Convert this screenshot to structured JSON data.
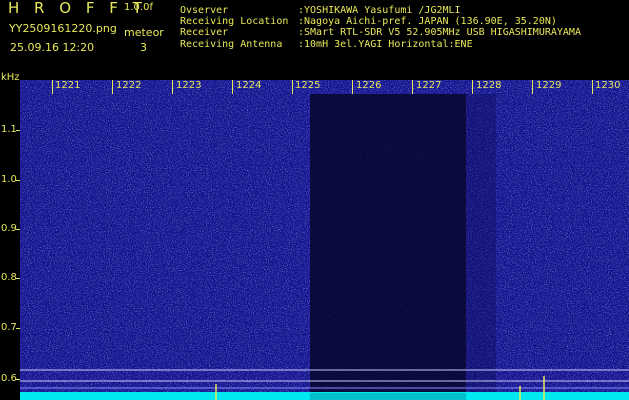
{
  "header": {
    "app_name": "H R O F F T",
    "version": "1.0.0f",
    "filename": "YY2509161220.png",
    "datetime": "25.09.16 12:20",
    "meteor_label": "meteor",
    "meteor_count": "3"
  },
  "info": [
    {
      "key": "Ovserver",
      "value": ":YOSHIKAWA Yasufumi /JG2MLI"
    },
    {
      "key": "Receiving Location",
      "value": ":Nagoya Aichi-pref. JAPAN (136.90E, 35.20N)"
    },
    {
      "key": "Receiver",
      "value": ":SMart RTL-SDR V5 52.905MHz USB HIGASHIMURAYAMA"
    },
    {
      "key": "Receiving Antenna",
      "value": ":10mH 3el.YAGI Horizontal:ENE"
    }
  ],
  "axes": {
    "y_unit": "kHz",
    "y_ticks": [
      "1.1",
      "1.0",
      "0.9",
      "0.8",
      "0.7",
      "0.6"
    ],
    "x_ticks": [
      "1221",
      "1222",
      "1223",
      "1224",
      "1225",
      "1226",
      "1227",
      "1228",
      "1229",
      "1230"
    ]
  },
  "colors": {
    "text": "#e8e85a",
    "background": "#000000",
    "spectrum": "#1a1aa0",
    "baseline": "#00e8f0"
  }
}
